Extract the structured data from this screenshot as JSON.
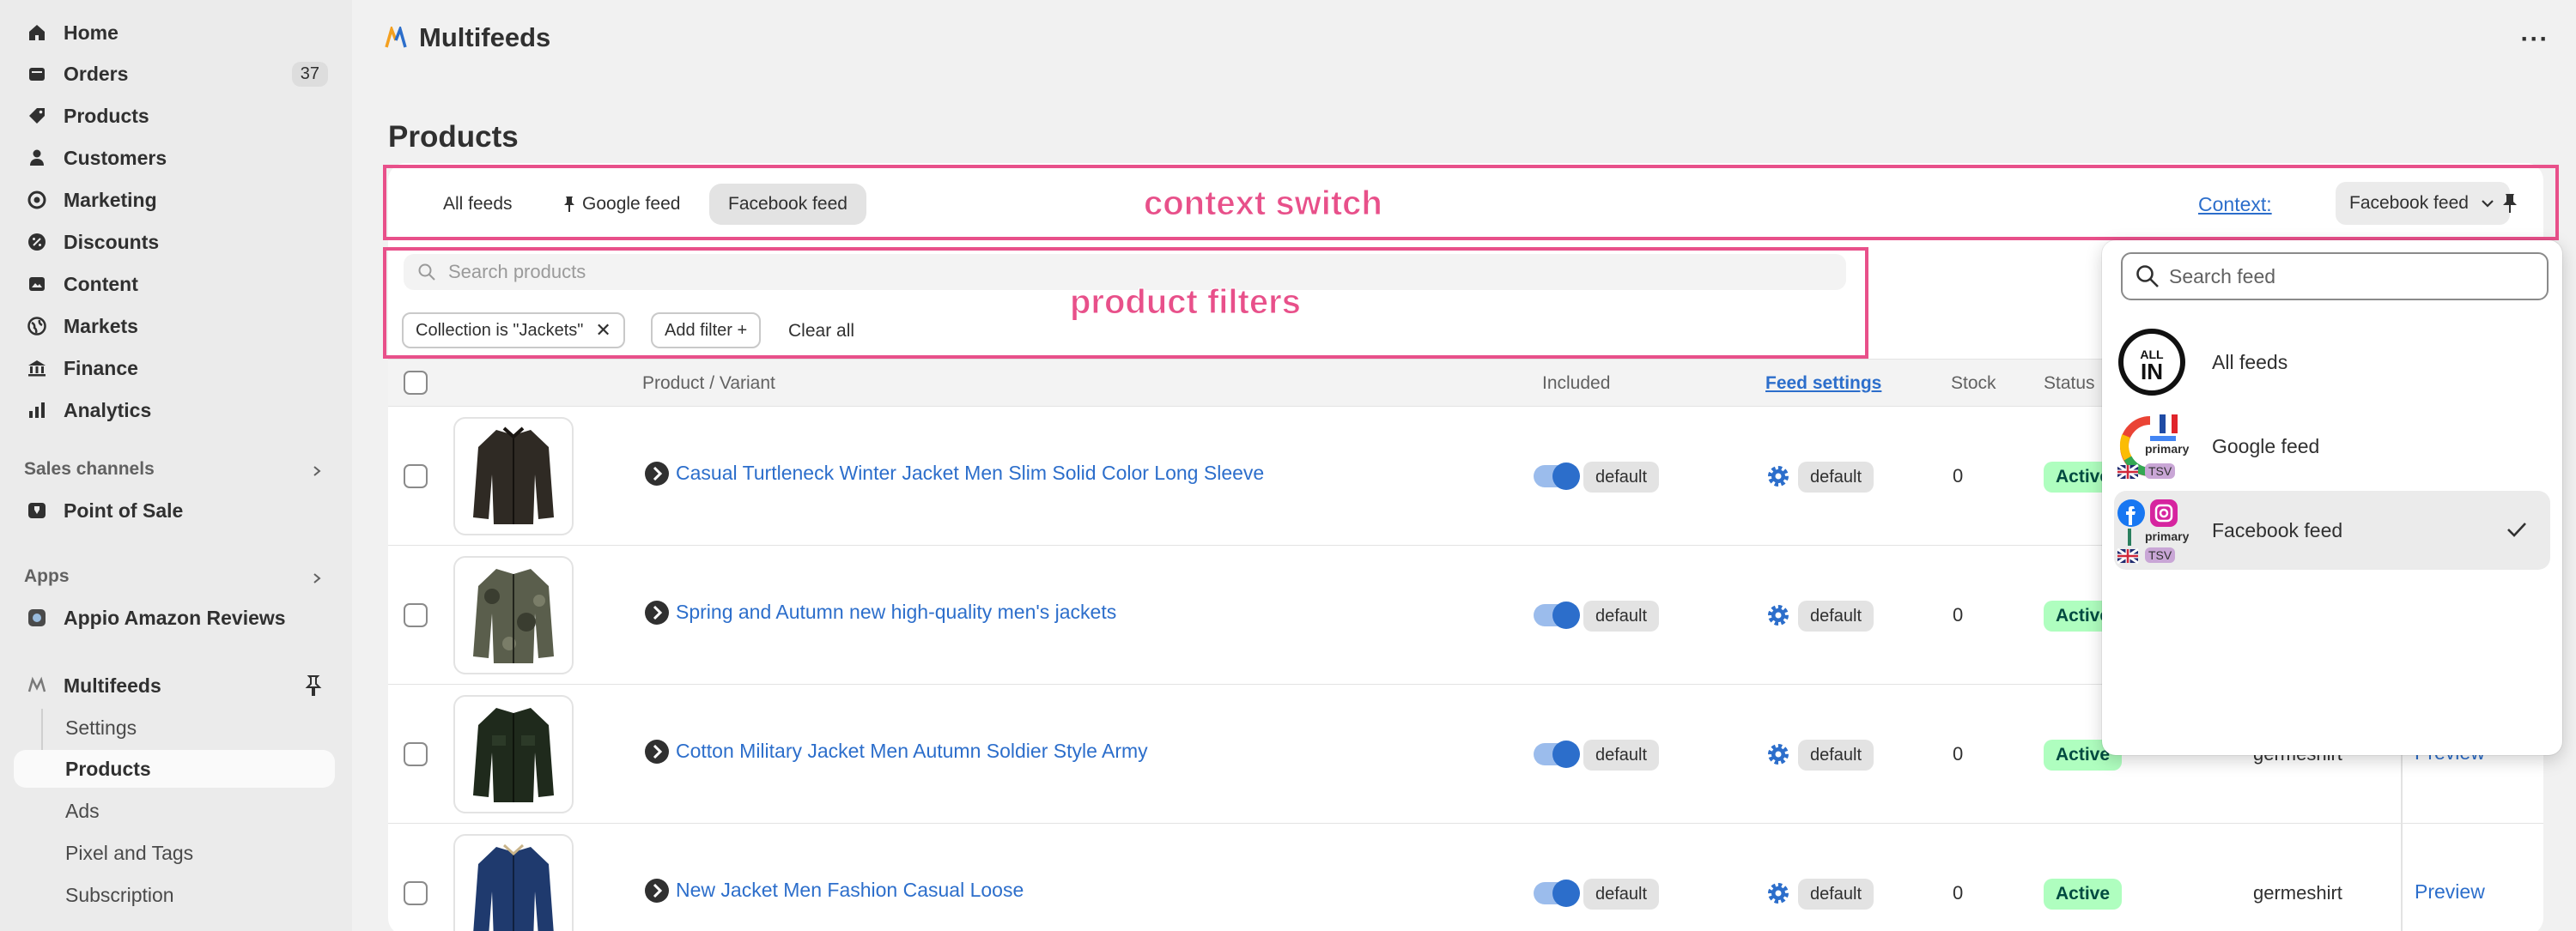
{
  "sidebar": {
    "nav": [
      {
        "label": "Home",
        "icon": "home-icon"
      },
      {
        "label": "Orders",
        "icon": "orders-icon",
        "badge": "37"
      },
      {
        "label": "Products",
        "icon": "tag-icon"
      },
      {
        "label": "Customers",
        "icon": "person-icon"
      },
      {
        "label": "Marketing",
        "icon": "target-icon"
      },
      {
        "label": "Discounts",
        "icon": "discount-icon"
      },
      {
        "label": "Content",
        "icon": "content-icon"
      },
      {
        "label": "Markets",
        "icon": "globe-icon"
      },
      {
        "label": "Finance",
        "icon": "bank-icon"
      },
      {
        "label": "Analytics",
        "icon": "chart-icon"
      }
    ],
    "sales_channels_label": "Sales channels",
    "point_of_sale": "Point of Sale",
    "apps_label": "Apps",
    "appio": "Appio Amazon Reviews",
    "multifeeds": "Multifeeds",
    "sub_items": [
      "Settings",
      "Products",
      "Ads",
      "Pixel and Tags",
      "Subscription"
    ],
    "active_sub": "Products"
  },
  "header": {
    "app_name": "Multifeeds",
    "more": "···"
  },
  "page_title": "Products",
  "tabs": [
    {
      "label": "All feeds",
      "pinned": false,
      "selected": false
    },
    {
      "label": "Google feed",
      "pinned": true,
      "selected": false
    },
    {
      "label": "Facebook feed",
      "pinned": false,
      "selected": true
    }
  ],
  "context": {
    "link": "Context:",
    "value": "Facebook feed"
  },
  "search": {
    "placeholder": "Search products"
  },
  "filters": {
    "chip": "Collection is \"Jackets\"",
    "chip_remove": "✕",
    "add_filter": "Add filter +",
    "clear_all": "Clear all"
  },
  "table": {
    "columns": {
      "product": "Product / Variant",
      "included": "Included",
      "feed_settings": "Feed settings",
      "stock": "Stock",
      "status": "Status"
    },
    "rows": [
      {
        "name": "Casual Turtleneck Winter Jacket Men Slim Solid Color Long Sleeve",
        "included": "default",
        "feed": "default",
        "stock": "0",
        "status": "Active",
        "vendor": "",
        "preview": ""
      },
      {
        "name": "Spring and Autumn new high-quality men's jackets",
        "included": "default",
        "feed": "default",
        "stock": "0",
        "status": "Active",
        "vendor": "",
        "preview": ""
      },
      {
        "name": "Cotton Military Jacket Men Autumn Soldier  Style Army",
        "included": "default",
        "feed": "default",
        "stock": "0",
        "status": "Active",
        "vendor": "germeshirt",
        "preview": "Preview"
      },
      {
        "name": "New Jacket Men Fashion Casual Loose",
        "included": "default",
        "feed": "default",
        "stock": "0",
        "status": "Active",
        "vendor": "germeshirt",
        "preview": "Preview"
      }
    ]
  },
  "annotations": {
    "context_switch": "context switch",
    "product_filters": "product filters"
  },
  "dropdown": {
    "placeholder": "Search feed",
    "items": [
      {
        "label": "All feeds",
        "icon": "all-in-icon",
        "selected": false
      },
      {
        "label": "Google feed",
        "icon": "google-icon",
        "badge_primary": "primary",
        "badge_format": "TSV",
        "selected": false
      },
      {
        "label": "Facebook feed",
        "icon": "facebook-instagram-icon",
        "badge_primary": "primary",
        "badge_format": "TSV",
        "selected": true
      }
    ]
  },
  "colors": {
    "accent": "#2c6ecb",
    "annotation": "#e8508a",
    "status_bg": "#affebf",
    "status_text": "#014b40"
  }
}
